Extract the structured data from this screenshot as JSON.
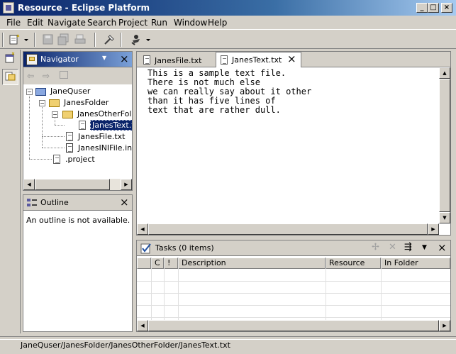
{
  "window": {
    "title": "Resource - Eclipse Platform",
    "controls": [
      "_",
      "□",
      "×"
    ]
  },
  "menu": [
    "File",
    "Edit",
    "Navigate",
    "Search",
    "Project",
    "Run",
    "Window",
    "Help"
  ],
  "navigator": {
    "title": "Navigator",
    "close": "×",
    "tree": [
      {
        "label": "JaneQuser"
      },
      {
        "label": "JanesFolder"
      },
      {
        "label": "JanesOtherFolder"
      },
      {
        "label": "JanesText.txt"
      },
      {
        "label": "JanesFile.txt"
      },
      {
        "label": "JanesINIFile.ini"
      },
      {
        "label": ".project"
      }
    ]
  },
  "outline": {
    "title": "Outline",
    "close": "×",
    "message": "An outline is not available."
  },
  "editor": {
    "tabs": [
      {
        "label": "JanesFile.txt"
      },
      {
        "label": "JanesText.txt",
        "close": "×"
      }
    ],
    "lines": [
      "This is a sample text file.",
      "There is not much else",
      "we can really say about it other",
      "than it has five lines of",
      "text that are rather dull."
    ]
  },
  "tasks": {
    "title": "Tasks (0 items)",
    "close": "×",
    "columns": [
      "C",
      "!",
      "Description",
      "Resource",
      "In Folder"
    ]
  },
  "status": {
    "path": "JaneQuser/JanesFolder/JanesOtherFolder/JanesText.txt"
  }
}
